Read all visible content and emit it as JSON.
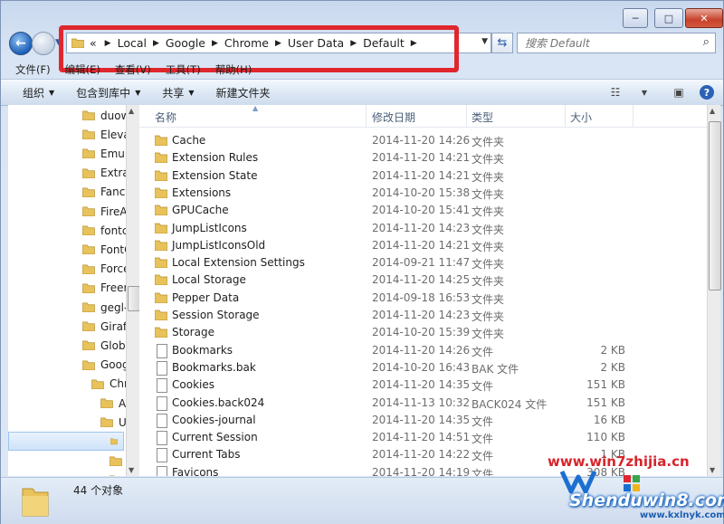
{
  "window": {
    "controls": {
      "minimize": "─",
      "maximize": "□",
      "close": "✕"
    }
  },
  "address": {
    "overflow": "«",
    "crumbs": [
      "Local",
      "Google",
      "Chrome",
      "User Data",
      "Default"
    ],
    "search_placeholder": "搜索 Default"
  },
  "menubar": [
    "文件(F)",
    "编辑(E)",
    "查看(V)",
    "工具(T)",
    "帮助(H)"
  ],
  "toolbar": {
    "organize": "组织",
    "include_in_library": "包含到库中",
    "share": "共享",
    "new_folder": "新建文件夹",
    "help": "?"
  },
  "nav_items": [
    {
      "label": "duow",
      "indent": 0
    },
    {
      "label": "Eleva",
      "indent": 0
    },
    {
      "label": "Emur",
      "indent": 0
    },
    {
      "label": "Extra",
      "indent": 0
    },
    {
      "label": "Fancy",
      "indent": 0
    },
    {
      "label": "FireA",
      "indent": 0
    },
    {
      "label": "fontc",
      "indent": 0
    },
    {
      "label": "FontC",
      "indent": 0
    },
    {
      "label": "Force",
      "indent": 0
    },
    {
      "label": "Freer",
      "indent": 0
    },
    {
      "label": "gegl-",
      "indent": 0
    },
    {
      "label": "Giraf",
      "indent": 0
    },
    {
      "label": "Glob",
      "indent": 0
    },
    {
      "label": "Goog",
      "indent": 0
    },
    {
      "label": "Chr",
      "indent": 1
    },
    {
      "label": "A",
      "indent": 2
    },
    {
      "label": "U",
      "indent": 2
    },
    {
      "label": "",
      "indent": 3,
      "selected": true
    },
    {
      "label": "",
      "indent": 3
    },
    {
      "label": "",
      "indent": 3
    }
  ],
  "columns": {
    "name": "名称",
    "date": "修改日期",
    "type": "类型",
    "size": "大小"
  },
  "files": [
    {
      "name": "Cache",
      "date": "2014-11-20 14:26",
      "type": "文件夹",
      "size": "",
      "kind": "folder"
    },
    {
      "name": "Extension Rules",
      "date": "2014-11-20 14:21",
      "type": "文件夹",
      "size": "",
      "kind": "folder"
    },
    {
      "name": "Extension State",
      "date": "2014-11-20 14:21",
      "type": "文件夹",
      "size": "",
      "kind": "folder"
    },
    {
      "name": "Extensions",
      "date": "2014-10-20 15:38",
      "type": "文件夹",
      "size": "",
      "kind": "folder"
    },
    {
      "name": "GPUCache",
      "date": "2014-10-20 15:41",
      "type": "文件夹",
      "size": "",
      "kind": "folder"
    },
    {
      "name": "JumpListIcons",
      "date": "2014-11-20 14:23",
      "type": "文件夹",
      "size": "",
      "kind": "folder"
    },
    {
      "name": "JumpListIconsOld",
      "date": "2014-11-20 14:21",
      "type": "文件夹",
      "size": "",
      "kind": "folder"
    },
    {
      "name": "Local Extension Settings",
      "date": "2014-09-21 11:47",
      "type": "文件夹",
      "size": "",
      "kind": "folder"
    },
    {
      "name": "Local Storage",
      "date": "2014-11-20 14:25",
      "type": "文件夹",
      "size": "",
      "kind": "folder"
    },
    {
      "name": "Pepper Data",
      "date": "2014-09-18 16:53",
      "type": "文件夹",
      "size": "",
      "kind": "folder"
    },
    {
      "name": "Session Storage",
      "date": "2014-11-20 14:23",
      "type": "文件夹",
      "size": "",
      "kind": "folder"
    },
    {
      "name": "Storage",
      "date": "2014-10-20 15:39",
      "type": "文件夹",
      "size": "",
      "kind": "folder"
    },
    {
      "name": "Bookmarks",
      "date": "2014-11-20 14:26",
      "type": "文件",
      "size": "2 KB",
      "kind": "file"
    },
    {
      "name": "Bookmarks.bak",
      "date": "2014-10-20 16:43",
      "type": "BAK 文件",
      "size": "2 KB",
      "kind": "file"
    },
    {
      "name": "Cookies",
      "date": "2014-11-20 14:35",
      "type": "文件",
      "size": "151 KB",
      "kind": "file"
    },
    {
      "name": "Cookies.back024",
      "date": "2014-11-13 10:32",
      "type": "BACK024 文件",
      "size": "151 KB",
      "kind": "file"
    },
    {
      "name": "Cookies-journal",
      "date": "2014-11-20 14:35",
      "type": "文件",
      "size": "16 KB",
      "kind": "file"
    },
    {
      "name": "Current Session",
      "date": "2014-11-20 14:51",
      "type": "文件",
      "size": "110 KB",
      "kind": "file"
    },
    {
      "name": "Current Tabs",
      "date": "2014-11-20 14:22",
      "type": "文件",
      "size": "1 KB",
      "kind": "file"
    },
    {
      "name": "Favicons",
      "date": "2014-11-20 14:19",
      "type": "文件",
      "size": "308 KB",
      "kind": "file"
    }
  ],
  "status": {
    "count": "44 个对象"
  },
  "watermark": {
    "site1": "www.win7zhijia.cn",
    "site2": "Shenduwin8.com",
    "site3": "www.kxlnyk.com"
  },
  "colors": {
    "folder": "#e8c25a",
    "highlight": "#e0272e",
    "selection": "#cfe3fa"
  }
}
